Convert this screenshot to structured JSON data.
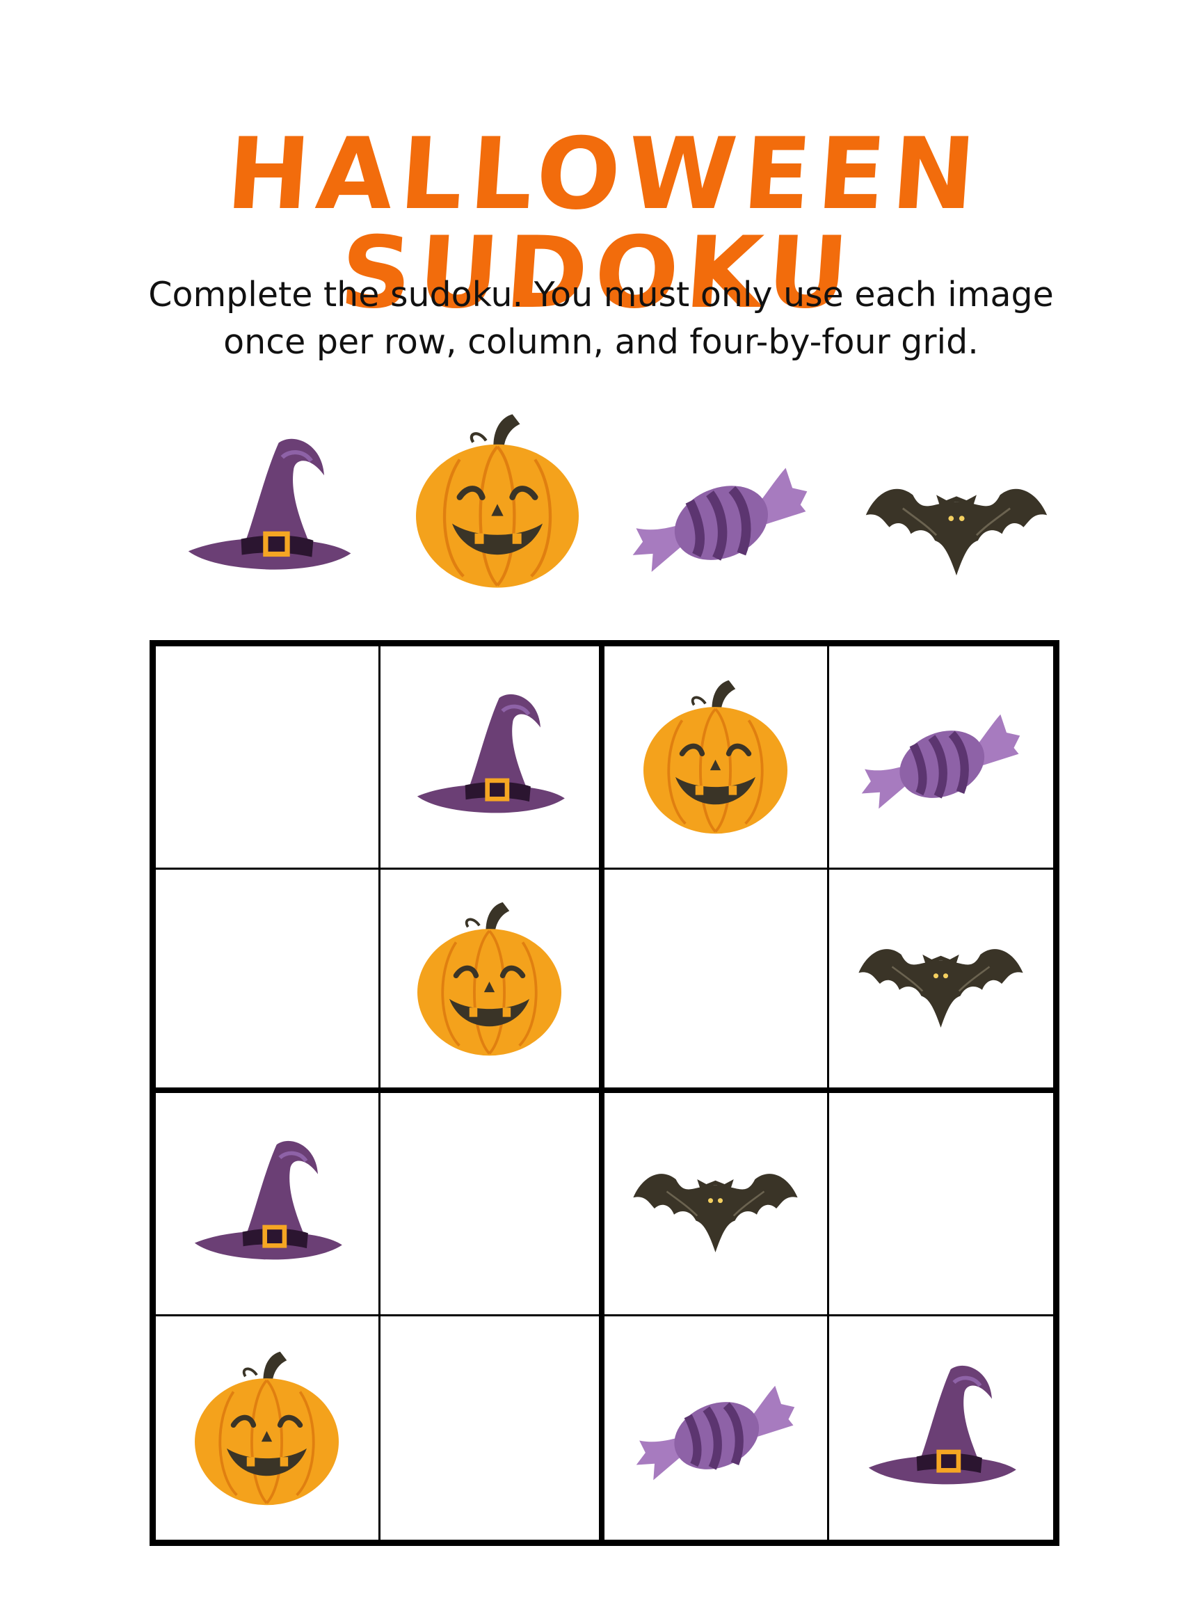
{
  "title": "HALLOWEEN SUDOKU",
  "instructions": "Complete the sudoku. You must only use each image once per row, column, and four-by-four grid.",
  "legend": [
    "witch-hat",
    "pumpkin",
    "candy",
    "bat"
  ],
  "grid": [
    [
      "",
      "witch-hat",
      "pumpkin",
      "candy"
    ],
    [
      "",
      "pumpkin",
      "",
      "bat"
    ],
    [
      "witch-hat",
      "",
      "bat",
      ""
    ],
    [
      "pumpkin",
      "",
      "candy",
      "witch-hat"
    ]
  ],
  "colors": {
    "title": "#f26c0c",
    "hat": "#6b3f75",
    "pumpkin": "#f4a21c",
    "candy": "#8e62a7",
    "bat": "#3a3427"
  }
}
